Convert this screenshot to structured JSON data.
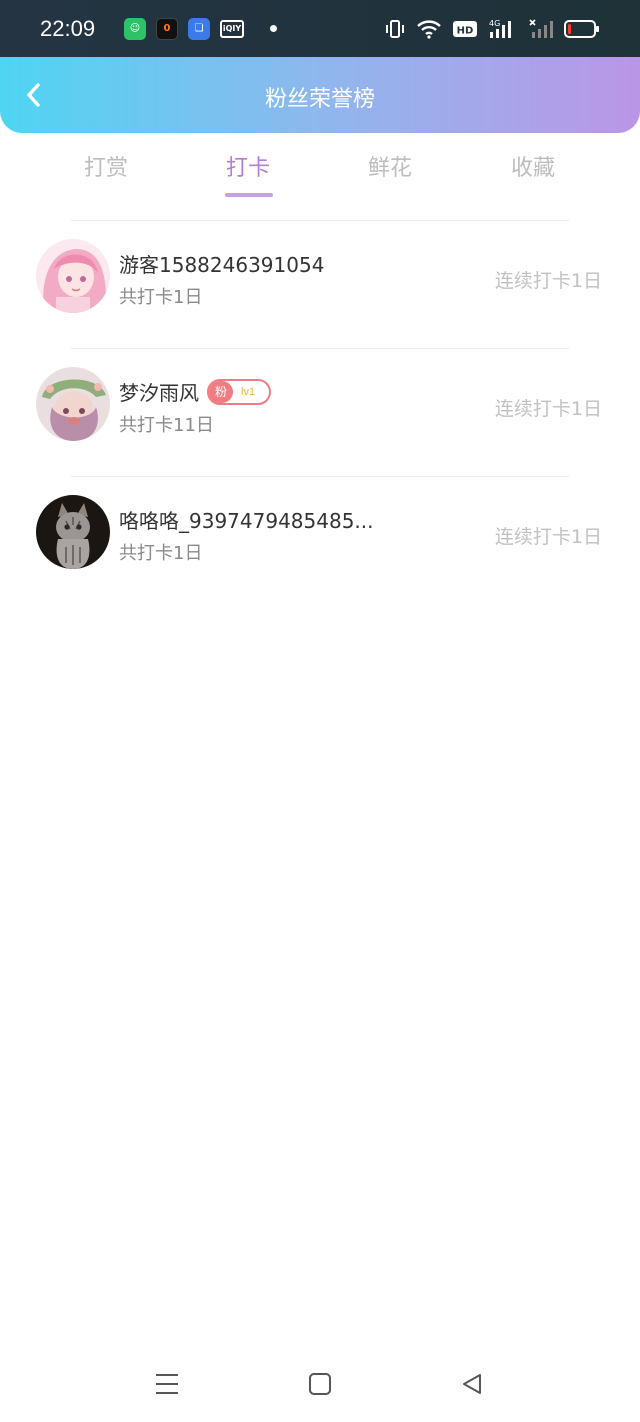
{
  "status_bar": {
    "time": "22:09",
    "apps": [
      {
        "icon": "green-app-icon",
        "glyph": "☺"
      },
      {
        "icon": "fitness-app-icon",
        "glyph": "0"
      },
      {
        "icon": "files-app-icon",
        "glyph": "❏"
      },
      {
        "icon": "iqiyi-app-icon",
        "glyph": "iQIY"
      }
    ],
    "hd_label": "HD",
    "network_label": "4G",
    "battery_level": 0.1,
    "colors": {
      "battery_low": "#ff3b30"
    }
  },
  "header": {
    "title": "粉丝荣誉榜",
    "back_icon": "chevron-left-icon",
    "gradient": [
      "#4fd5f2",
      "#8fb7ee",
      "#bb96e6"
    ]
  },
  "tabs": {
    "items": [
      "打赏",
      "打卡",
      "鲜花",
      "收藏"
    ],
    "active_index": 1,
    "active_color": "#b07fd8"
  },
  "list": [
    {
      "name": "游客1588246391054",
      "sub": "共打卡1日",
      "right": "连续打卡1日",
      "badge": null,
      "avatar": "anime-girl-pink-avatar"
    },
    {
      "name": "梦汐雨风",
      "sub": "共打卡11日",
      "right": "连续打卡1日",
      "badge": {
        "label": "粉",
        "level": "lv1"
      },
      "avatar": "anime-girl-green-hat-avatar"
    },
    {
      "name": "咯咯咯_9397479485485...",
      "sub": "共打卡1日",
      "right": "连续打卡1日",
      "badge": null,
      "avatar": "cat-avatar"
    }
  ],
  "bottom_nav": {
    "icons": [
      "menu-icon",
      "home-icon",
      "back-triangle-icon"
    ]
  }
}
